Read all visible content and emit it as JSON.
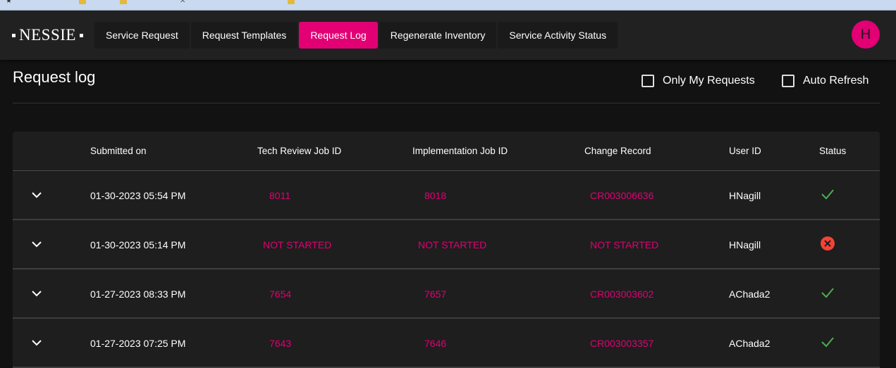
{
  "app": {
    "logo_text": "NESSIE",
    "brand_color": "#e20074",
    "avatar_initial": "H"
  },
  "nav": {
    "tabs": [
      {
        "label": "Service Request",
        "active": false
      },
      {
        "label": "Request Templates",
        "active": false
      },
      {
        "label": "Request Log",
        "active": true
      },
      {
        "label": "Regenerate Inventory",
        "active": false
      },
      {
        "label": "Service Activity Status",
        "active": false
      }
    ]
  },
  "page": {
    "title": "Request log",
    "only_my_requests_label": "Only My Requests",
    "only_my_requests_checked": false,
    "auto_refresh_label": "Auto Refresh",
    "auto_refresh_checked": false
  },
  "table": {
    "columns": [
      "Submitted on",
      "Tech Review Job ID",
      "Implementation Job ID",
      "Change Record",
      "User ID",
      "Status"
    ],
    "rows": [
      {
        "submitted_on": "01-30-2023 05:54 PM",
        "tech_review_job_id": "8011",
        "implementation_job_id": "8018",
        "change_record": "CR003006636",
        "user_id": "HNagill",
        "status": "success"
      },
      {
        "submitted_on": "01-30-2023 05:14 PM",
        "tech_review_job_id": "NOT STARTED",
        "implementation_job_id": "NOT STARTED",
        "change_record": "NOT STARTED",
        "user_id": "HNagill",
        "status": "error"
      },
      {
        "submitted_on": "01-27-2023 08:33 PM",
        "tech_review_job_id": "7654",
        "implementation_job_id": "7657",
        "change_record": "CR003003602",
        "user_id": "AChada2",
        "status": "success"
      },
      {
        "submitted_on": "01-27-2023 07:25 PM",
        "tech_review_job_id": "7643",
        "implementation_job_id": "7646",
        "change_record": "CR003003357",
        "user_id": "AChada2",
        "status": "success"
      }
    ]
  },
  "colors": {
    "success": "#4caf50",
    "error": "#f44336",
    "link": "#e20074"
  }
}
